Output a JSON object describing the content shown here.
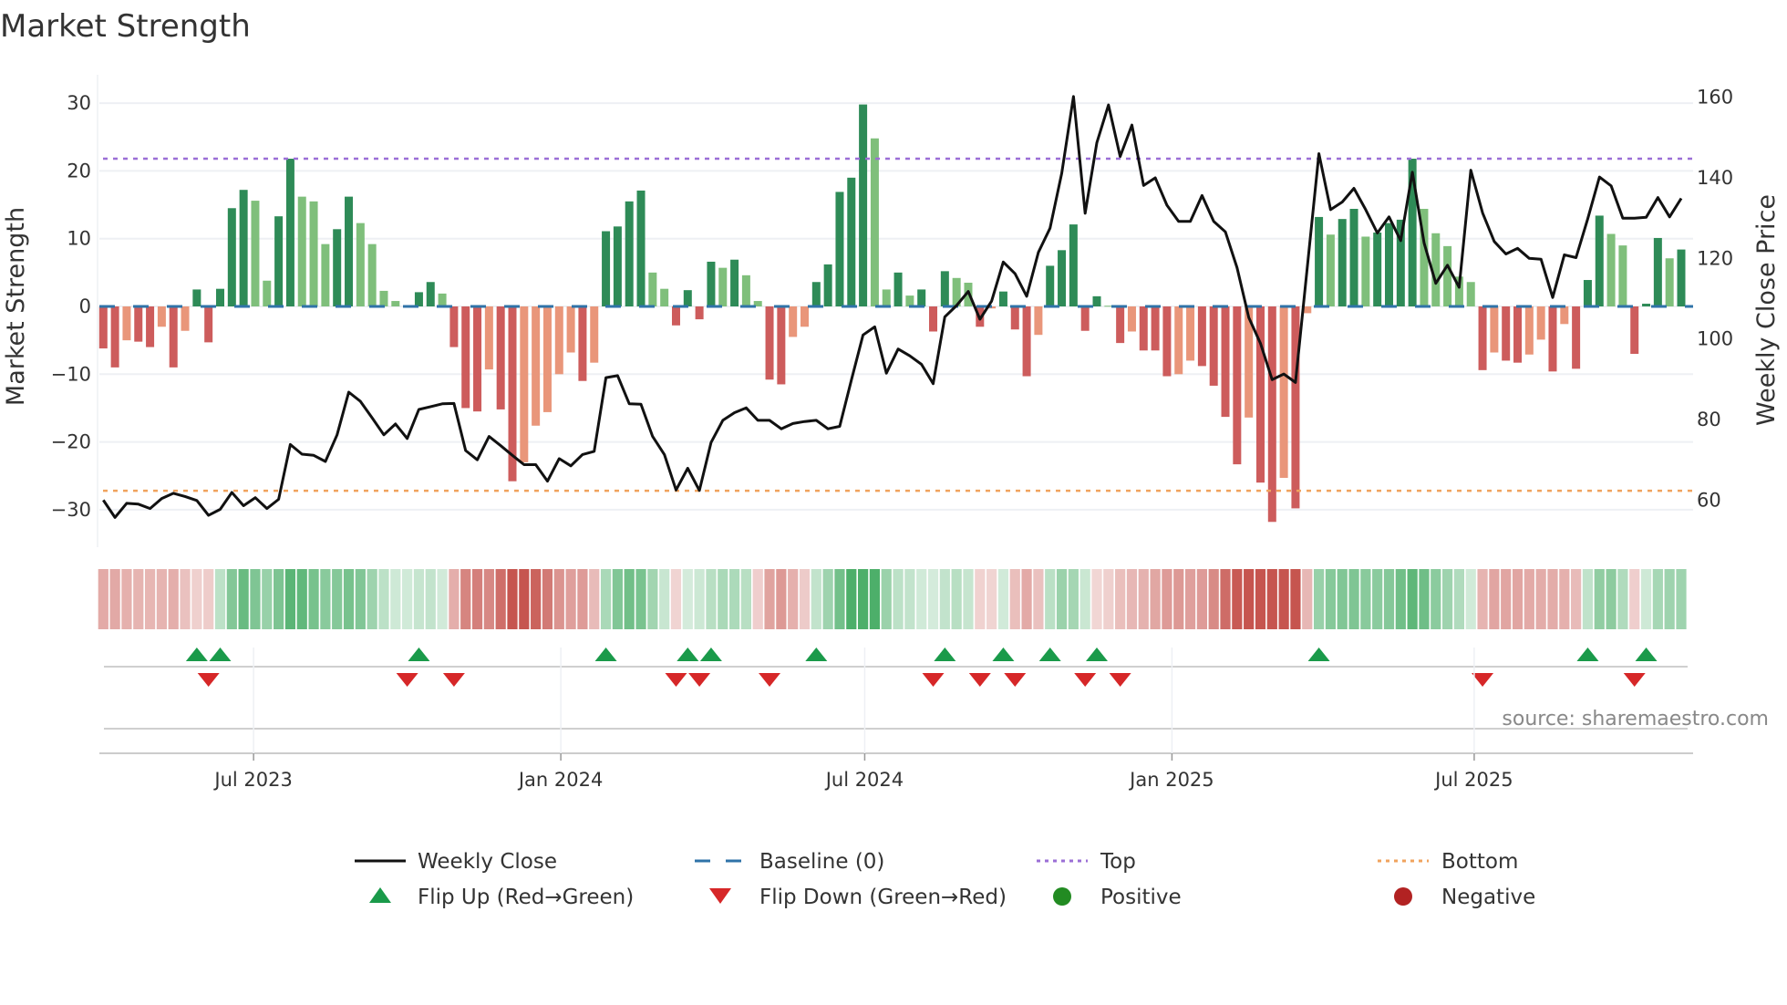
{
  "chart_data": {
    "type": "bar",
    "title": "Market Strength",
    "ylabel": "Market Strength",
    "y2label": "Weekly Close Price",
    "ylim": [
      -34,
      34
    ],
    "y2lim": [
      50,
      165
    ],
    "yticks": [
      30,
      20,
      10,
      0,
      -10,
      -20,
      -30
    ],
    "y2ticks": [
      160,
      140,
      120,
      100,
      80,
      60
    ],
    "grid": true,
    "x_frequency": "weekly",
    "week_start": "2023-04-02",
    "xticks": [
      {
        "label": "Jul 2023",
        "date": "2023-07-01"
      },
      {
        "label": "Jan 2024",
        "date": "2024-01-01"
      },
      {
        "label": "Jul 2024",
        "date": "2024-07-01"
      },
      {
        "label": "Jan 2025",
        "date": "2025-01-01"
      },
      {
        "label": "Jul 2025",
        "date": "2025-07-01"
      }
    ],
    "top_level": 21.8,
    "bottom_level": -27.2,
    "baseline": 0,
    "colors": {
      "strong_positive": "#2e8b57",
      "weak_positive": "#7fbf7b",
      "strong_negative": "#cd5c5c",
      "weak_negative": "#e9967a",
      "baseline": "#2f73a8",
      "top": "#9b6fd6",
      "bottom": "#f0a35e",
      "close": "#111111",
      "flip_up": "#1a9a4a",
      "flip_down": "#d62728",
      "positive": "#228b22",
      "negative": "#b22222",
      "strip_positive": "#3aa65a",
      "strip_negative": "#c0433c"
    },
    "series": [
      {
        "name": "Market Strength",
        "axis": "left",
        "values": [
          -6.2,
          -9,
          -5,
          -5.2,
          -6,
          -3,
          -9,
          -3.6,
          2.5,
          -5.3,
          2.6,
          14.5,
          17.2,
          15.6,
          3.8,
          13.3,
          21.8,
          16.2,
          15.5,
          9.2,
          11.4,
          16.2,
          12.3,
          9.2,
          2.3,
          0.8,
          0,
          2.1,
          3.6,
          1.9,
          -6,
          -15,
          -15.5,
          -9.3,
          -15.2,
          -25.8,
          -23,
          -17.6,
          -15.6,
          -10,
          -6.8,
          -11,
          -8.3,
          11.1,
          11.8,
          15.5,
          17.1,
          5,
          2.6,
          -2.8,
          2.4,
          -1.9,
          6.6,
          5.7,
          6.9,
          4.6,
          0.8,
          -10.8,
          -11.5,
          -4.5,
          -3,
          3.6,
          6.2,
          16.9,
          19,
          29.8,
          24.8,
          2.5,
          5,
          1.6,
          2.5,
          -3.7,
          5.2,
          4.2,
          3.5,
          -3,
          -0.3,
          2.2,
          -3.4,
          -10.3,
          -4.2,
          6,
          8.3,
          12.1,
          -3.6,
          1.5,
          0.1,
          -5.4,
          -3.7,
          -6.5,
          -6.5,
          -10.3,
          -10,
          -8,
          -8.8,
          -11.7,
          -16.3,
          -23.3,
          -16.4,
          -26,
          -31.8,
          -25.3,
          -29.8,
          -1,
          13.2,
          10.6,
          12.9,
          14.4,
          10.3,
          10.9,
          12.3,
          12.8,
          21.8,
          14.4,
          10.8,
          8.9,
          4.4,
          3.6,
          -9.4,
          -6.8,
          -8,
          -8.3,
          -7.1,
          -4.9,
          -9.6,
          -2.6,
          -9.2,
          3.9,
          13.4,
          10.7,
          9,
          -7,
          0.4,
          10.1,
          7.1,
          8.4
        ]
      },
      {
        "name": "Weekly Close",
        "axis": "right",
        "values": [
          60.0,
          55.7,
          59.2,
          59.0,
          57.9,
          60.4,
          61.7,
          60.9,
          59.9,
          56.2,
          57.7,
          61.9,
          58.6,
          60.6,
          57.9,
          60.2,
          73.8,
          71.4,
          71.1,
          69.6,
          76.2,
          86.8,
          84.5,
          80.4,
          76.2,
          78.9,
          75.3,
          82.5,
          83.2,
          83.9,
          84.0,
          72.3,
          70.0,
          75.8,
          73.5,
          71.1,
          68.8,
          68.8,
          64.7,
          70.3,
          68.5,
          71.3,
          72.1,
          90.4,
          90.9,
          83.9,
          83.8,
          75.8,
          71.3,
          62.5,
          67.9,
          62.4,
          74.3,
          79.8,
          81.7,
          82.9,
          79.8,
          79.8,
          77.7,
          79.0,
          79.5,
          79.8,
          77.7,
          78.3,
          89.8,
          101.0,
          103.0,
          91.5,
          97.5,
          95.8,
          93.7,
          88.9,
          105.5,
          108.3,
          111.8,
          104.9,
          109.4,
          119.1,
          116.2,
          110.6,
          121.5,
          127.5,
          141.1,
          160.2,
          131.2,
          148.7,
          158.1,
          145.3,
          153.1,
          138.1,
          140.0,
          133.2,
          129.2,
          129.2,
          135.6,
          129.2,
          126.6,
          117.7,
          105.3,
          98.9,
          89.9,
          91.3,
          89.2,
          117.7,
          146.0,
          132.1,
          134.0,
          137.4,
          132.1,
          126.3,
          130.3,
          124.4,
          141.4,
          123.8,
          113.8,
          118.3,
          112.8,
          141.9,
          131.3,
          124.2,
          121.1,
          122.5,
          120.0,
          119.8,
          110.3,
          120.9,
          120.2,
          129.8,
          140.2,
          138.0,
          130.0,
          130.0,
          130.2,
          135.1,
          130.3,
          134.9
        ]
      }
    ],
    "flip_up_weeks": [
      8,
      10,
      27,
      43,
      50,
      52,
      61,
      72,
      77,
      81,
      85,
      104,
      127,
      132
    ],
    "flip_down_weeks": [
      9,
      26,
      30,
      49,
      51,
      57,
      71,
      75,
      78,
      84,
      87,
      118,
      131
    ],
    "legend": [
      {
        "label": "Weekly Close",
        "kind": "line"
      },
      {
        "label": "Baseline (0)",
        "kind": "dashed"
      },
      {
        "label": "Top",
        "kind": "dotted-top"
      },
      {
        "label": "Bottom",
        "kind": "dotted-bottom"
      },
      {
        "label": "Flip Up (Red→Green)",
        "kind": "triangle-up"
      },
      {
        "label": "Flip Down (Green→Red)",
        "kind": "triangle-down"
      },
      {
        "label": "Positive",
        "kind": "circle-positive"
      },
      {
        "label": "Negative",
        "kind": "circle-negative"
      }
    ],
    "legend_position": "bottom",
    "source": "source: sharemaestro.com"
  }
}
